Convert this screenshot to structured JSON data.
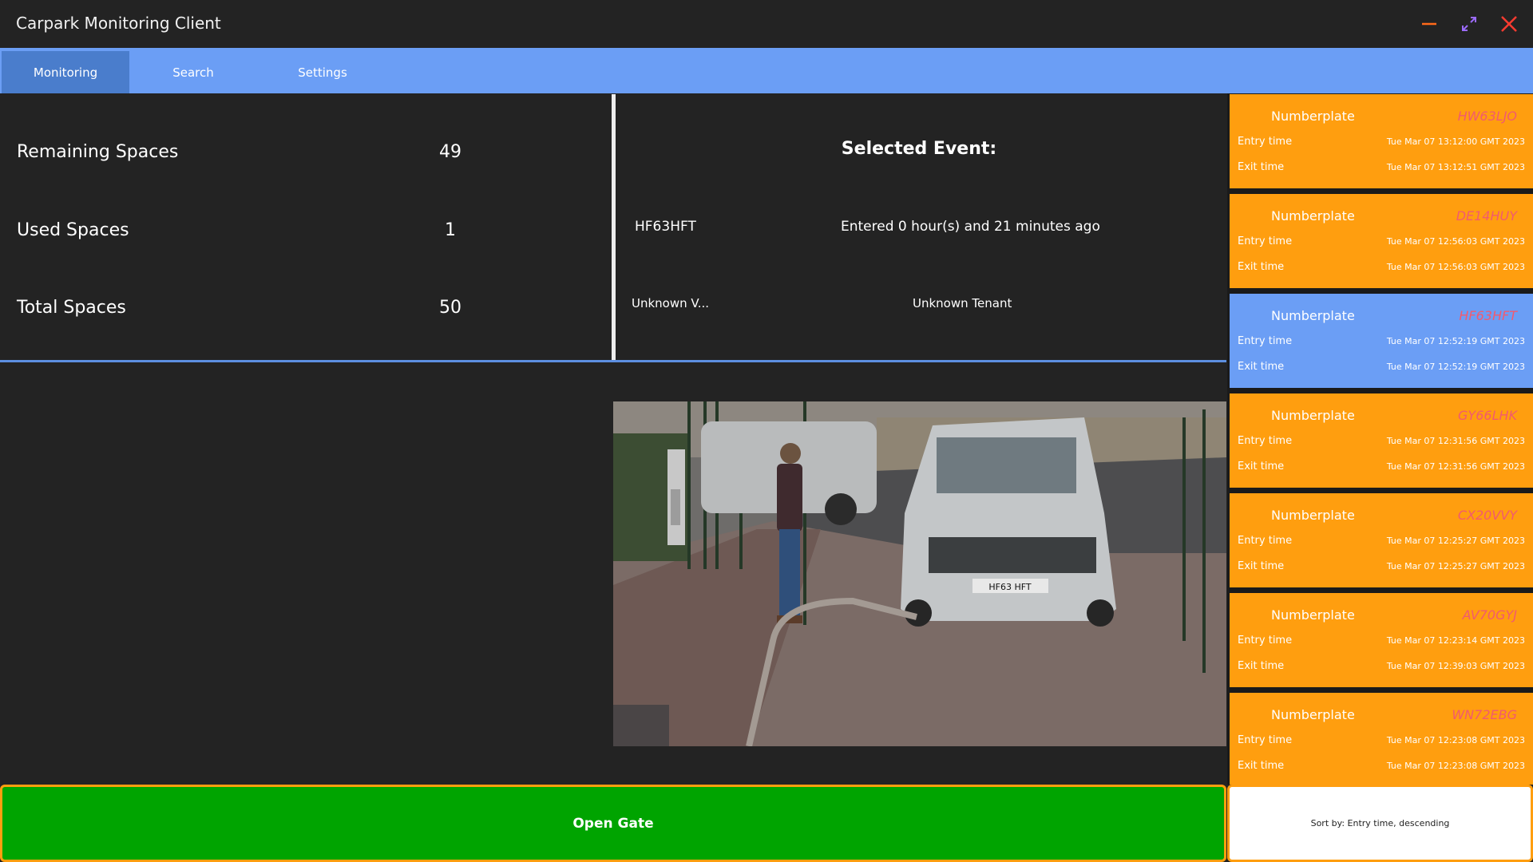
{
  "window": {
    "title": "Carpark Monitoring Client",
    "controls": [
      "minimize-icon",
      "maximize-icon",
      "close-icon"
    ],
    "colors": {
      "minimize": "#ff6a1a",
      "maximize": "#9b6bff",
      "close": "#ff3b30"
    }
  },
  "tabs": [
    {
      "label": "Monitoring",
      "active": true
    },
    {
      "label": "Search",
      "active": false
    },
    {
      "label": "Settings",
      "active": false
    }
  ],
  "stats": {
    "remaining": {
      "label": "Remaining Spaces",
      "value": "49"
    },
    "used": {
      "label": "Used Spaces",
      "value": "1"
    },
    "total": {
      "label": "Total Spaces",
      "value": "50"
    }
  },
  "selected_event": {
    "title": "Selected Event:",
    "plate": "HF63HFT",
    "elapsed": "Entered 0 hour(s) and 21 minutes ago",
    "vehicle": "Unknown V...",
    "tenant": "Unknown Tenant"
  },
  "camera": {
    "plate_text": "HF63 HFT"
  },
  "events": [
    {
      "label": "Numberplate",
      "plate": "HW63LJO",
      "entry_label": "Entry time",
      "entry": "Tue Mar 07 13:12:00 GMT 2023",
      "exit_label": "Exit time",
      "exit": "Tue Mar 07 13:12:51 GMT 2023",
      "selected": false
    },
    {
      "label": "Numberplate",
      "plate": "DE14HUY",
      "entry_label": "Entry time",
      "entry": "Tue Mar 07 12:56:03 GMT 2023",
      "exit_label": "Exit time",
      "exit": "Tue Mar 07 12:56:03 GMT 2023",
      "selected": false
    },
    {
      "label": "Numberplate",
      "plate": "HF63HFT",
      "entry_label": "Entry time",
      "entry": "Tue Mar 07 12:52:19 GMT 2023",
      "exit_label": "Exit time",
      "exit": "Tue Mar 07 12:52:19 GMT 2023",
      "selected": true
    },
    {
      "label": "Numberplate",
      "plate": "GY66LHK",
      "entry_label": "Entry time",
      "entry": "Tue Mar 07 12:31:56 GMT 2023",
      "exit_label": "Exit time",
      "exit": "Tue Mar 07 12:31:56 GMT 2023",
      "selected": false
    },
    {
      "label": "Numberplate",
      "plate": "CX20VVY",
      "entry_label": "Entry time",
      "entry": "Tue Mar 07 12:25:27 GMT 2023",
      "exit_label": "Exit time",
      "exit": "Tue Mar 07 12:25:27 GMT 2023",
      "selected": false
    },
    {
      "label": "Numberplate",
      "plate": "AV70GYJ",
      "entry_label": "Entry time",
      "entry": "Tue Mar 07 12:23:14 GMT 2023",
      "exit_label": "Exit time",
      "exit": "Tue Mar 07 12:39:03 GMT 2023",
      "selected": false
    },
    {
      "label": "Numberplate",
      "plate": "WN72EBG",
      "entry_label": "Entry time",
      "entry": "Tue Mar 07 12:23:08 GMT 2023",
      "exit_label": "Exit time",
      "exit": "Tue Mar 07 12:23:08 GMT 2023",
      "selected": false
    }
  ],
  "actions": {
    "open_gate": "Open Gate",
    "sort": "Sort by: Entry time, descending"
  },
  "colors": {
    "card_default": "#ff9e0f",
    "card_selected": "#6b9ef5",
    "plate_text": "#f25a6e",
    "open_gate": "#00a400",
    "tab_bar": "#6b9ef5",
    "tab_active": "#4a7dcc"
  }
}
